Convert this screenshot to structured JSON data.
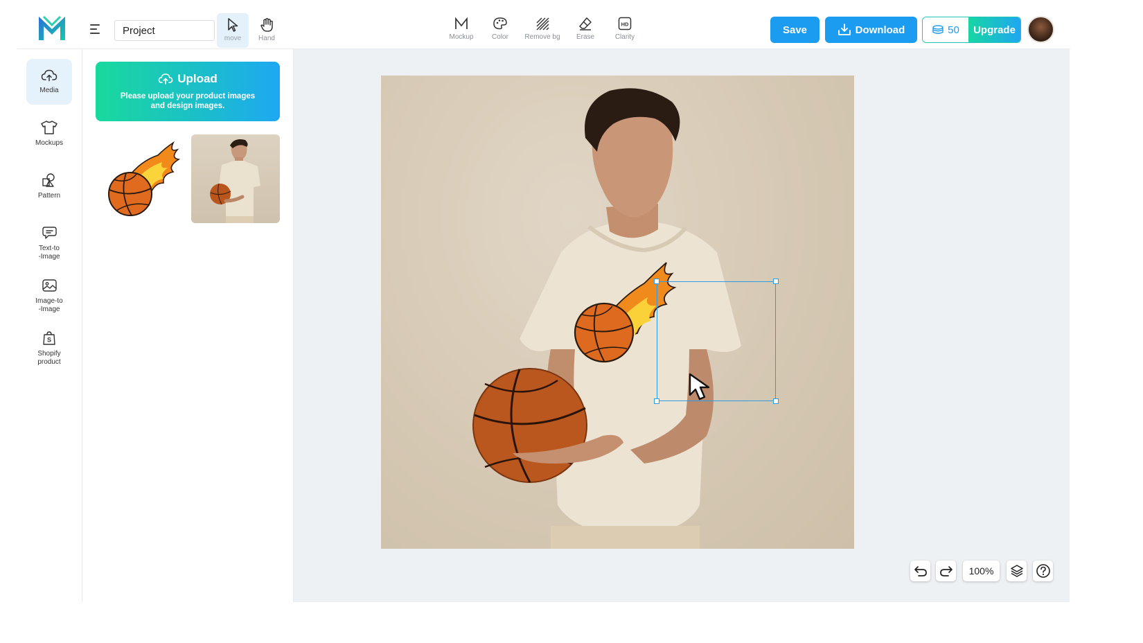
{
  "header": {
    "logo_icon": "m-logo-icon",
    "menu_icon": "hamburger-icon",
    "project_name": "Project",
    "tools": [
      {
        "label": "move",
        "icon": "cursor-arrow-icon",
        "active": true
      },
      {
        "label": "Hand",
        "icon": "hand-icon",
        "active": false
      }
    ],
    "mockup_tools": [
      {
        "label": "Mockup",
        "icon": "m-letter-icon"
      },
      {
        "label": "Color",
        "icon": "palette-icon"
      },
      {
        "label": "Remove bg",
        "icon": "diagonal-lines-icon"
      },
      {
        "label": "Erase",
        "icon": "eraser-icon"
      },
      {
        "label": "Clarity",
        "icon": "hd-icon"
      }
    ],
    "save_label": "Save",
    "download_label": "Download",
    "credits": "50",
    "upgrade_label": "Upgrade"
  },
  "sidebar": {
    "items": [
      {
        "label": "Media",
        "icon": "cloud-upload-icon",
        "active": true
      },
      {
        "label": "Mockups",
        "icon": "tshirt-icon",
        "active": false
      },
      {
        "label": "Pattern",
        "icon": "shapes-icon",
        "active": false
      },
      {
        "label_line1": "Text-to",
        "label_line2": "-Image",
        "icon": "chat-bubbles-icon",
        "active": false
      },
      {
        "label_line1": "Image-to",
        "label_line2": "-Image",
        "icon": "image-icon",
        "active": false
      },
      {
        "label_line1": "Shopify",
        "label_line2": "product",
        "icon": "shopping-bag-icon",
        "active": false
      }
    ]
  },
  "panel": {
    "upload_title": "Upload",
    "upload_description": "Please upload your product images and design images.",
    "thumbnails": [
      "flaming-basketball-design",
      "man-holding-basketball-photo"
    ]
  },
  "canvas": {
    "zoom": "100%"
  },
  "colors": {
    "primary": "#1b9cf0",
    "gradient_start": "#19d99d",
    "gradient_end": "#1ea8f2",
    "selection": "#2c9be8",
    "canvas_bg": "#eef1f4"
  }
}
